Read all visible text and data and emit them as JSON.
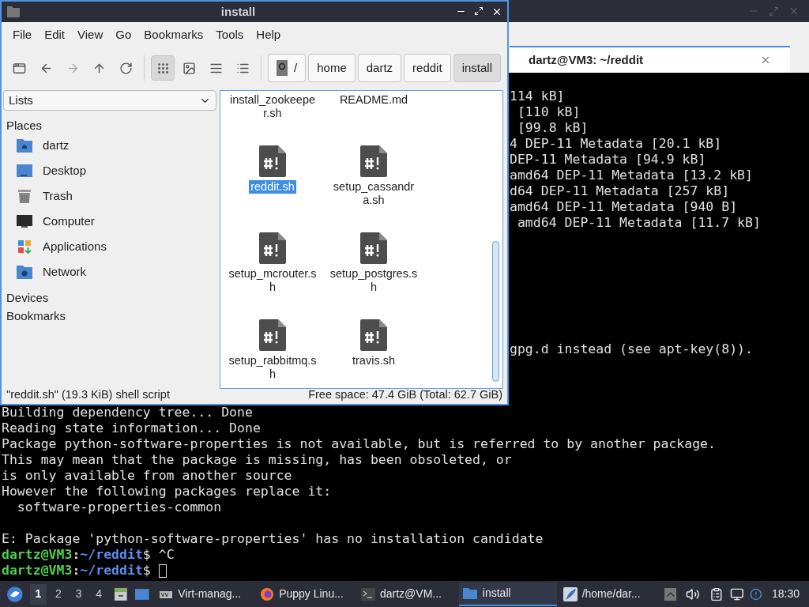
{
  "terminal_window": {
    "tab": {
      "title": "dartz@VM3: ~/reddit",
      "selected": true
    },
    "top_lines": [
      "114 kB]",
      " [110 kB]",
      " [99.8 kB]",
      "4 DEP-11 Metadata [20.1 kB]",
      "DEP-11 Metadata [94.9 kB]",
      "amd64 DEP-11 Metadata [13.2 kB]",
      "d64 DEP-11 Metadata [257 kB]",
      "amd64 DEP-11 Metadata [940 B]",
      " amd64 DEP-11 Metadata [11.7 kB]"
    ],
    "middle_lines": [
      "gpg.d instead (see apt-key(8))."
    ],
    "bottom_blocks": [
      [
        {
          "kind": "output",
          "text": "Building dependency tree... Done"
        },
        {
          "kind": "output",
          "text": "Reading state information... Done"
        },
        {
          "kind": "output",
          "text": "Package python-software-properties is not available, but is referred to by another package."
        },
        {
          "kind": "output",
          "text": "This may mean that the package is missing, has been obsoleted, or"
        },
        {
          "kind": "output",
          "text": "is only available from another source"
        },
        {
          "kind": "output",
          "text": "However the following packages replace it:"
        },
        {
          "kind": "output",
          "text": "  software-properties-common"
        }
      ],
      [
        {
          "kind": "output",
          "text": "E: Package 'python-software-properties' has no installation candidate"
        },
        {
          "kind": "prompt",
          "user": "dartz@VM3",
          "separator": ":",
          "path": "~/reddit",
          "symbol": "$",
          "command": " ^C"
        },
        {
          "kind": "prompt",
          "user": "dartz@VM3",
          "separator": ":",
          "path": "~/reddit",
          "symbol": "$",
          "cursor": true
        }
      ]
    ]
  },
  "file_manager": {
    "title": "install",
    "menu": [
      "File",
      "Edit",
      "View",
      "Go",
      "Bookmarks",
      "Tools",
      "Help"
    ],
    "tools": [
      {
        "kind": "new-tab",
        "disabled": false
      },
      {
        "kind": "back",
        "disabled": false
      },
      {
        "kind": "forward",
        "disabled": true
      },
      {
        "kind": "up",
        "disabled": false
      },
      {
        "kind": "reload",
        "disabled": false
      }
    ],
    "views": [
      {
        "kind": "icons",
        "selected": true
      },
      {
        "kind": "thumbnails",
        "selected": false
      },
      {
        "kind": "compact",
        "selected": false
      },
      {
        "kind": "details",
        "selected": false
      }
    ],
    "path": [
      {
        "label": "/",
        "kind": "root",
        "selected": false
      },
      {
        "label": "home",
        "selected": false
      },
      {
        "label": "dartz",
        "selected": false
      },
      {
        "label": "reddit",
        "selected": false
      },
      {
        "label": "install",
        "selected": true
      }
    ],
    "side_mode": "Lists",
    "sections": [
      {
        "title": "Places",
        "items": [
          {
            "label": "dartz",
            "kind": "home"
          },
          {
            "label": "Desktop",
            "kind": "desktop"
          },
          {
            "label": "Trash",
            "kind": "trash"
          },
          {
            "label": "Computer",
            "kind": "computer"
          },
          {
            "label": "Applications",
            "kind": "apps"
          },
          {
            "label": "Network",
            "kind": "network"
          }
        ]
      },
      {
        "title": "Devices"
      },
      {
        "title": "Bookmarks"
      }
    ],
    "files": [
      {
        "name": "install_zookeeper.sh",
        "kind": "cut",
        "selected": false
      },
      {
        "name": "README.md",
        "kind": "cut",
        "selected": false
      },
      {
        "name": "reddit.sh",
        "kind": "script",
        "selected": true
      },
      {
        "name": "setup_cassandra.sh",
        "kind": "script",
        "selected": false
      },
      {
        "name": "setup_mcrouter.sh",
        "kind": "script",
        "selected": false
      },
      {
        "name": "setup_postgres.sh",
        "kind": "script",
        "selected": false
      },
      {
        "name": "setup_rabbitmq.sh",
        "kind": "script",
        "selected": false
      },
      {
        "name": "travis.sh",
        "kind": "script",
        "selected": false
      }
    ],
    "status_left": "\"reddit.sh\" (19.3 KiB) shell script",
    "status_right": "Free space: 47.4 GiB (Total: 62.7 GiB)"
  },
  "taskbar": {
    "workspaces": [
      {
        "label": "1",
        "selected": true
      },
      {
        "label": "2",
        "selected": false
      },
      {
        "label": "3",
        "selected": false
      },
      {
        "label": "4",
        "selected": false
      }
    ],
    "tasks": [
      {
        "label": "Virt-manag...",
        "kind": "virt",
        "selected": false
      },
      {
        "label": "Puppy Linu...",
        "kind": "browser",
        "selected": false
      },
      {
        "label": "dartz@VM...",
        "kind": "terminal",
        "selected": false
      },
      {
        "label": "install",
        "kind": "folder",
        "selected": true
      },
      {
        "label": "/home/dar...",
        "kind": "editor",
        "selected": false
      }
    ],
    "clock": "18:30"
  }
}
